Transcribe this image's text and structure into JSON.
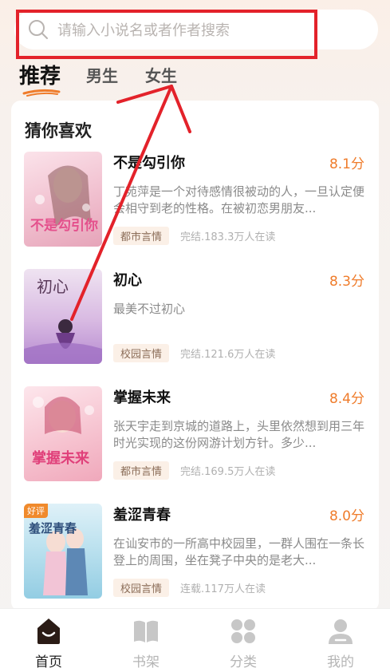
{
  "search": {
    "placeholder": "请输入小说名或者作者搜索"
  },
  "tabs": [
    {
      "label": "推荐",
      "active": true
    },
    {
      "label": "男生",
      "active": false
    },
    {
      "label": "女生",
      "active": false
    }
  ],
  "section": {
    "title": "猜你喜欢"
  },
  "books": [
    {
      "title": "不是勾引你",
      "score": "8.1分",
      "description": "丁苑萍是一个对待感情很被动的人，一旦认定便会相守到老的性格。在被初恋男朋友...",
      "category": "都市言情",
      "meta": "完结.183.3万人在读",
      "cover_text": "不是勾引你"
    },
    {
      "title": "初心",
      "score": "8.3分",
      "description": "最美不过初心",
      "category": "校园言情",
      "meta": "完结.121.6万人在读",
      "cover_text": "初心"
    },
    {
      "title": "掌握未来",
      "score": "8.4分",
      "description": "张天宇走到京城的道路上，头里依然想到用三年时光实现的这份网游计划方针。多少...",
      "category": "都市言情",
      "meta": "完结.169.5万人在读",
      "cover_text": "掌握未来"
    },
    {
      "title": "羞涩青春",
      "score": "8.0分",
      "description": "在讪安市的一所高中校园里，一群人围在一条长登上的周围，坐在凳子中央的是老大...",
      "category": "校园言情",
      "meta": "连载.117万人在读",
      "cover_text": "羞涩青春",
      "badge": "好评"
    }
  ],
  "bottom_nav": [
    {
      "label": "首页",
      "icon": "home-icon",
      "active": true
    },
    {
      "label": "书架",
      "icon": "bookshelf-icon",
      "active": false
    },
    {
      "label": "分类",
      "icon": "category-icon",
      "active": false
    },
    {
      "label": "我的",
      "icon": "profile-icon",
      "active": false
    }
  ],
  "colors": {
    "accent": "#ef7c2b",
    "annotation": "#e3222a",
    "tag_bg": "#fbf0e7"
  }
}
